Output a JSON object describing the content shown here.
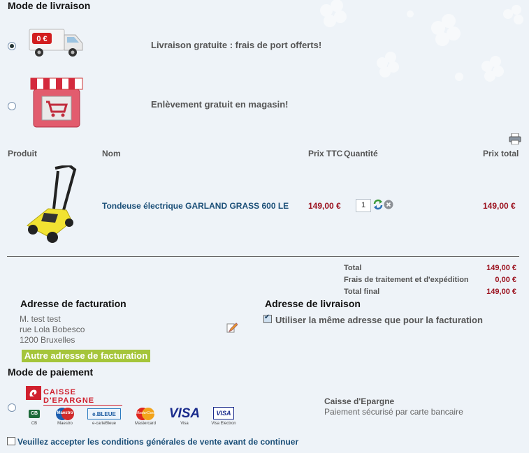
{
  "shipping": {
    "title": "Mode de livraison",
    "options": [
      {
        "label": "Livraison gratuite : frais de port offerts!",
        "icon": "delivery-truck-icon",
        "selected": true,
        "truck_badge": "0 €"
      },
      {
        "label": "Enlèvement gratuit en magasin!",
        "icon": "store-cart-icon",
        "selected": false
      }
    ]
  },
  "cart": {
    "headers": {
      "product": "Produit",
      "name": "Nom",
      "price": "Prix TTC",
      "quantity": "Quantité",
      "total": "Prix total"
    },
    "items": [
      {
        "name": "Tondeuse électrique GARLAND GRASS 600 LE",
        "price": "149,00 €",
        "quantity": "1",
        "total": "149,00 €",
        "image": "lawnmower-icon"
      }
    ],
    "print_icon": "printer-icon"
  },
  "totals": {
    "total_label": "Total",
    "total_value": "149,00 €",
    "fees_label": "Frais de traitement et d'expédition",
    "fees_value": "0,00 €",
    "final_label": "Total final",
    "final_value": "149,00 €"
  },
  "billing": {
    "title": "Adresse de facturation",
    "lines": [
      "M. test test",
      "rue Lola Bobesco",
      "1200 Bruxelles"
    ],
    "alt_button": "Autre adresse de facturation"
  },
  "delivery_address": {
    "title": "Adresse de livraison",
    "same_label": "Utiliser la même adresse que pour la facturation",
    "same_checked": true
  },
  "payment": {
    "title": "Mode de paiement",
    "bank_logo": "CAISSE D'EPARGNE",
    "name": "Caisse d'Epargne",
    "description": "Paiement sécurisé par carte bancaire",
    "cards": [
      {
        "name": "CB",
        "caption": "CB"
      },
      {
        "name": "Maestro",
        "caption": "Maestro"
      },
      {
        "name": "e.BLEUE",
        "caption": "e-carteBleue"
      },
      {
        "name": "MasterCard",
        "caption": "Mastercard"
      },
      {
        "name": "VISA",
        "caption": "Visa"
      },
      {
        "name": "VISA",
        "caption": "Visa Electron"
      }
    ]
  },
  "terms": {
    "label": "Veuillez accepter les conditions générales de vente avant de continuer",
    "checked": false
  },
  "colors": {
    "accent_green": "#a5c53a",
    "price_red": "#9b111e",
    "link_blue": "#1b4f78"
  }
}
